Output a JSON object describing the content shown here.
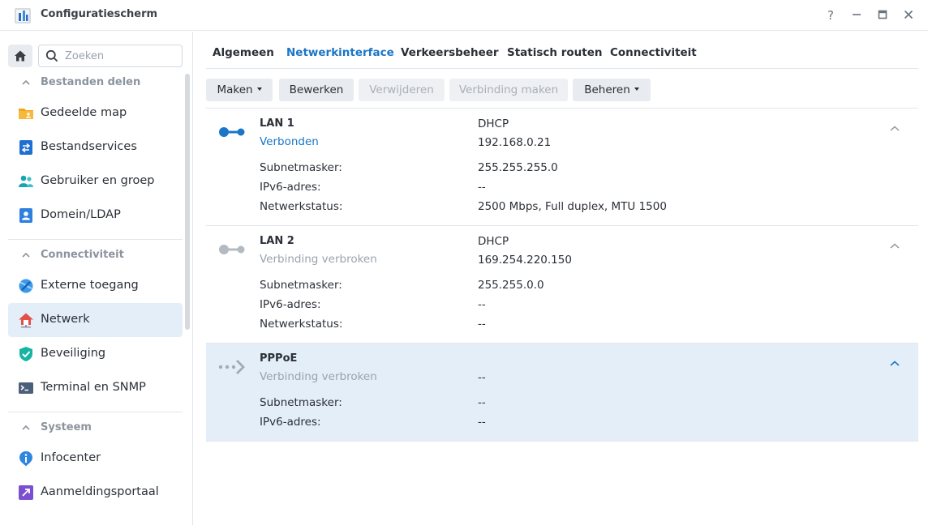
{
  "window": {
    "title": "Configuratiescherm",
    "controls": {
      "help": "?",
      "minimize": "—",
      "maximize": "☐",
      "close": "✕"
    }
  },
  "sidebar": {
    "search": {
      "placeholder": "Zoeken",
      "value": ""
    },
    "sections": [
      {
        "label": "Bestanden delen",
        "items": [
          "Gedeelde map",
          "Bestandservices",
          "Gebruiker en groep",
          "Domein/LDAP"
        ]
      },
      {
        "label": "Connectiviteit",
        "items": [
          "Externe toegang",
          "Netwerk",
          "Beveiliging",
          "Terminal en SNMP"
        ]
      },
      {
        "label": "Systeem",
        "items": [
          "Infocenter",
          "Aanmeldingsportaal"
        ]
      }
    ],
    "active_item": "Netwerk"
  },
  "tabs": [
    "Algemeen",
    "Netwerkinterface",
    "Verkeersbeheer",
    "Statisch routen",
    "Connectiviteit"
  ],
  "active_tab": "Netwerkinterface",
  "toolbar": {
    "create": "Maken",
    "edit": "Bewerken",
    "delete": "Verwijderen",
    "connect": "Verbinding maken",
    "manage": "Beheren"
  },
  "labels": {
    "subnet": "Subnetmasker:",
    "ipv6": "IPv6-adres:",
    "netstatus": "Netwerkstatus:"
  },
  "interfaces": [
    {
      "name": "LAN 1",
      "status": "Verbonden",
      "mode": "DHCP",
      "ip": "192.168.0.21",
      "subnet": "255.255.255.0",
      "ipv6": "--",
      "netstatus": "2500 Mbps, Full duplex, MTU 1500"
    },
    {
      "name": "LAN 2",
      "status": "Verbinding verbroken",
      "mode": "DHCP",
      "ip": "169.254.220.150",
      "subnet": "255.255.0.0",
      "ipv6": "--",
      "netstatus": "--"
    },
    {
      "name": "PPPoE",
      "status": "Verbinding verbroken",
      "ip": "--",
      "subnet": "--",
      "ipv6": "--"
    }
  ],
  "colors": {
    "accent": "#1a76c7",
    "selected_bg": "#e4eef9",
    "muted": "#9aa3ad"
  }
}
